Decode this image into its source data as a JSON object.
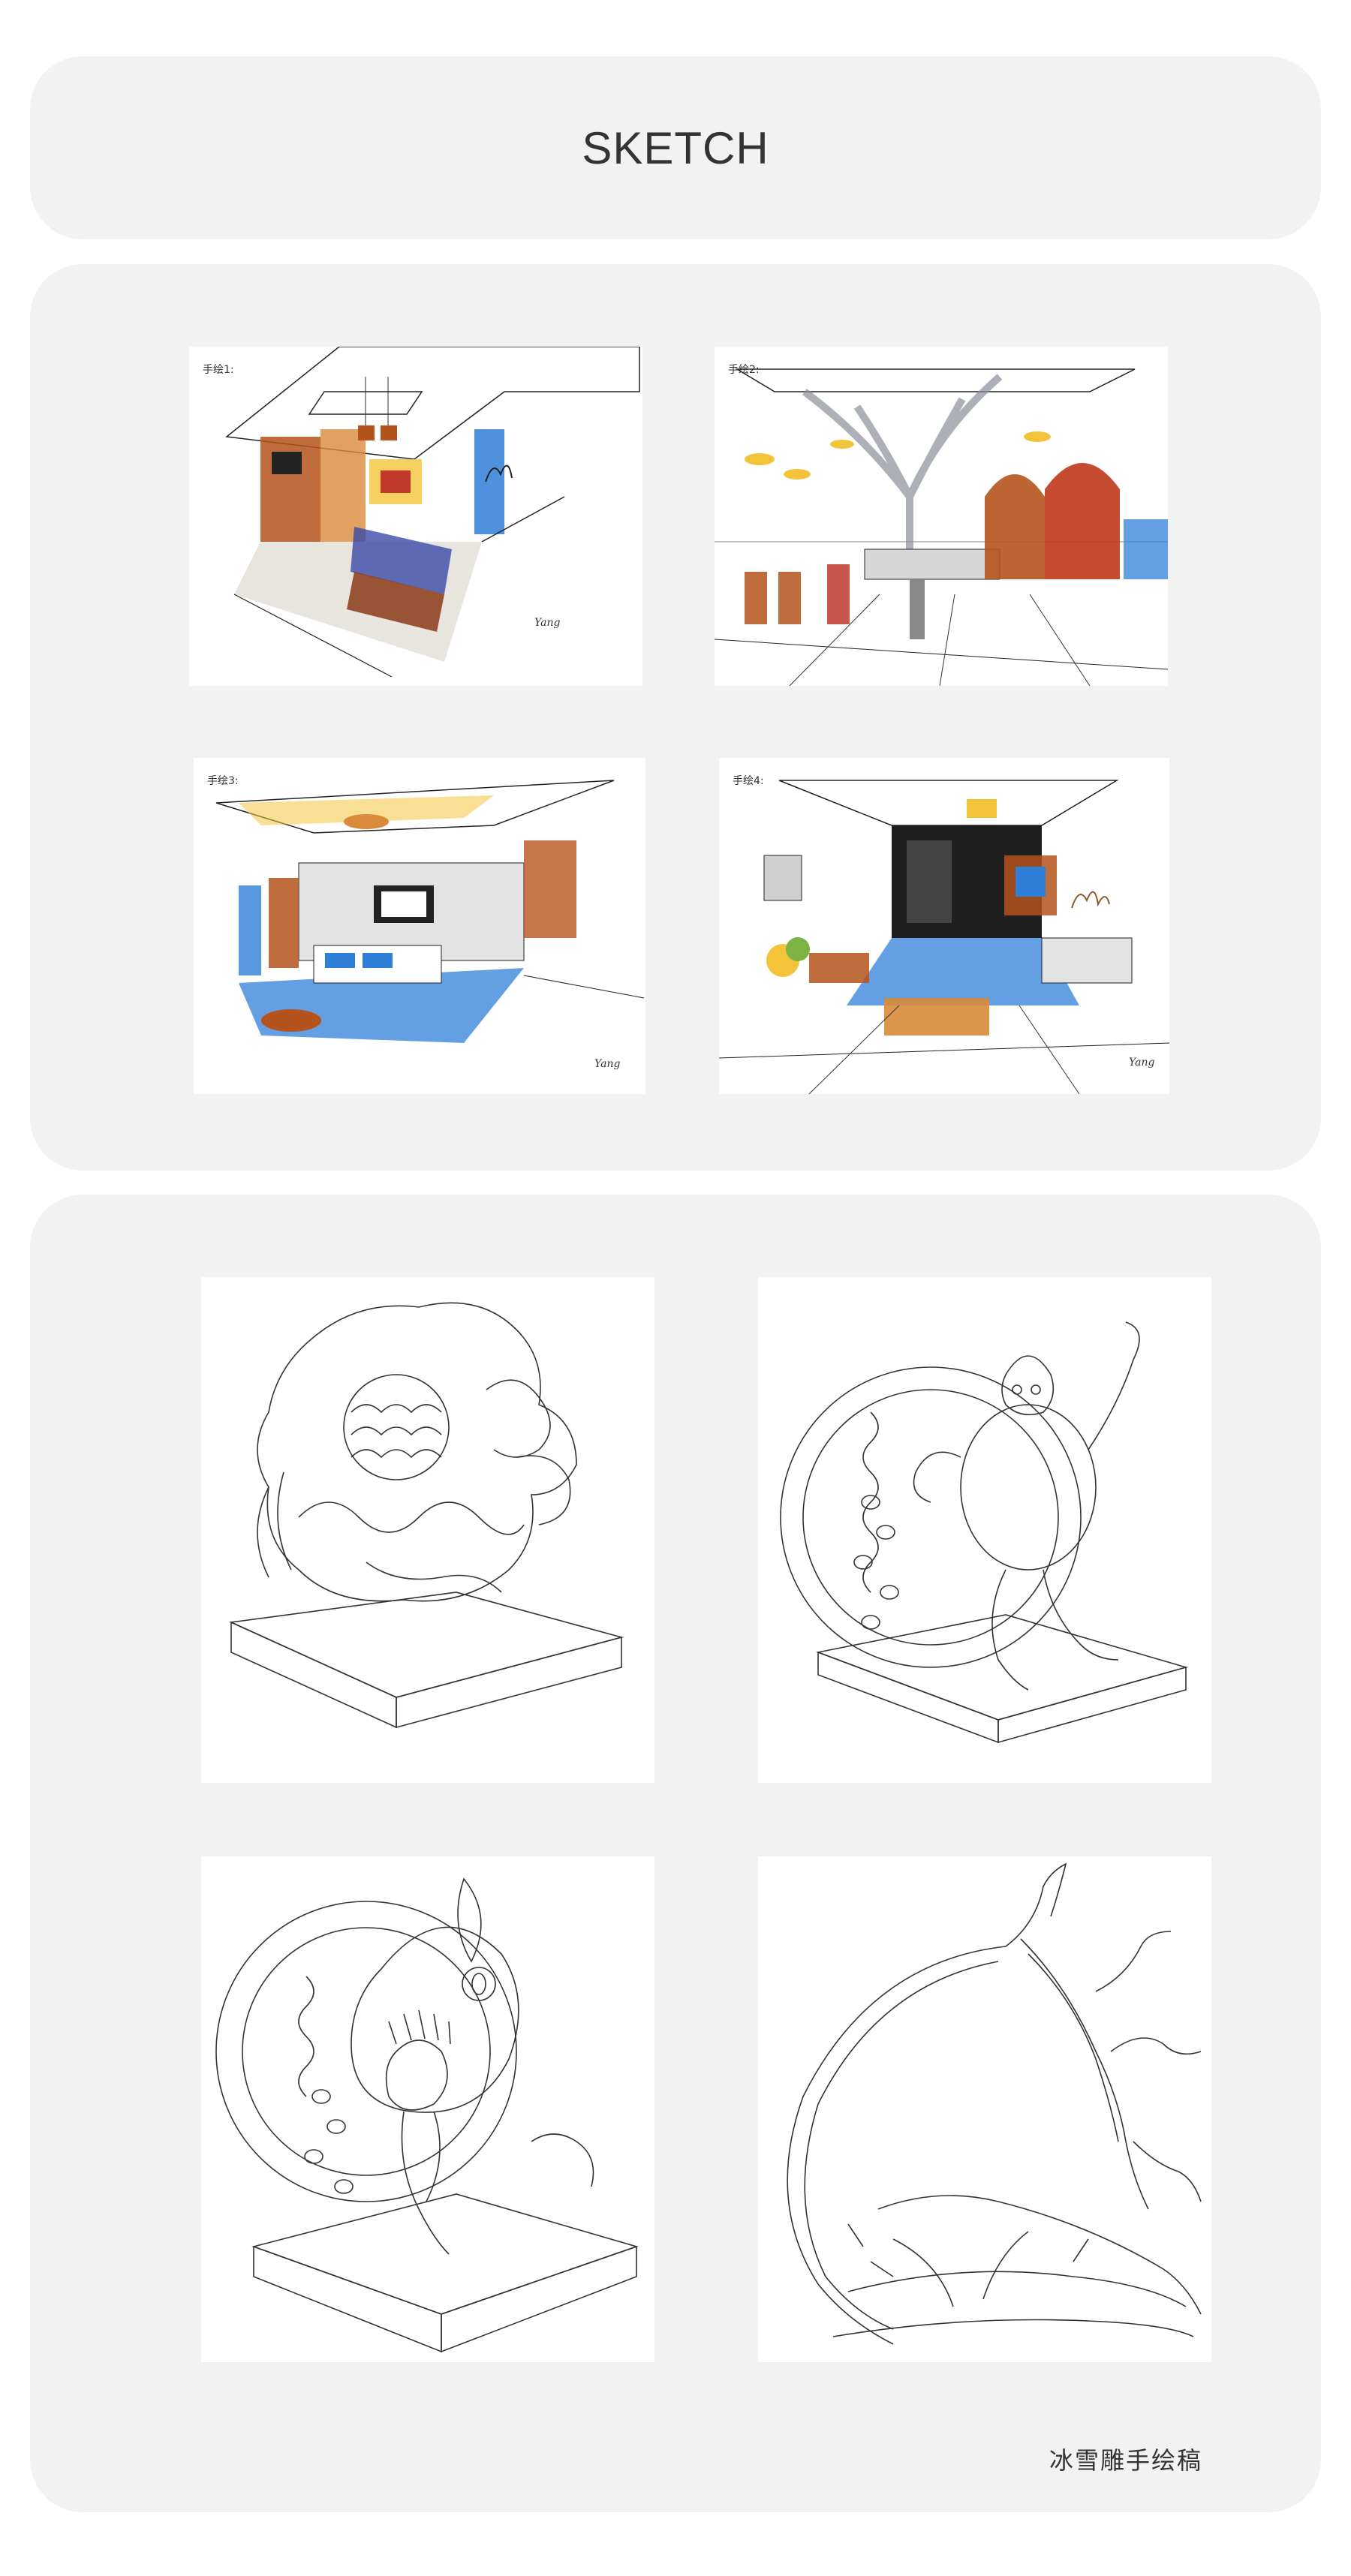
{
  "header": {
    "title": "SKETCH"
  },
  "interior_sketches": [
    {
      "label": "手绘1:",
      "signature": "Yang"
    },
    {
      "label": "手绘2:",
      "signature": ""
    },
    {
      "label": "手绘3:",
      "signature": "Yang"
    },
    {
      "label": "手绘4:",
      "signature": "Yang"
    }
  ],
  "sculpture_section": {
    "caption": "冰雪雕手绘稿"
  },
  "colors": {
    "page_background": "#ffffff",
    "panel_background": "#f2f2f2",
    "title_text": "#333333",
    "wood_accent": "#b5531c",
    "blue_accent": "#2f7fd8",
    "yellow_accent": "#f3c43a"
  }
}
